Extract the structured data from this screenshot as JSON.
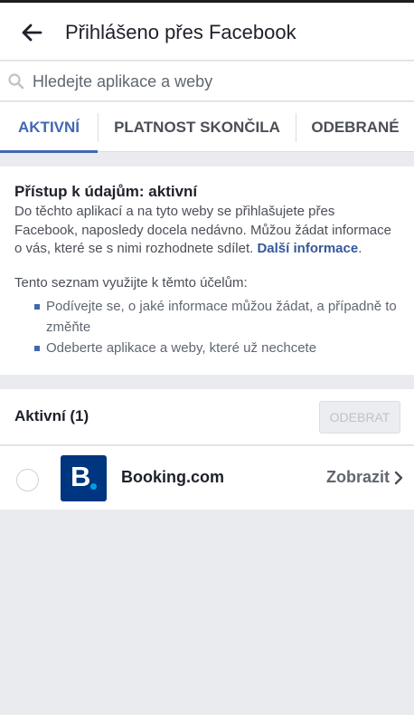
{
  "header": {
    "title": "Přihlášeno přes Facebook",
    "back_icon": "arrow-left-icon"
  },
  "search": {
    "placeholder": "Hledejte aplikace a weby",
    "value": "",
    "icon": "search-icon"
  },
  "tabs": [
    {
      "label": "AKTIVNÍ",
      "active": true
    },
    {
      "label": "PLATNOST SKONČILA",
      "active": false
    },
    {
      "label": "ODEBRANÉ",
      "active": false
    }
  ],
  "info": {
    "title": "Přístup k údajům: aktivní",
    "text": "Do těchto aplikací a na tyto weby se přihlašujete přes Facebook, naposledy docela nedávno. Můžou žádat informace o vás, které se s nimi rozhodnete sdílet.",
    "link": "Další informace",
    "after_link": ".",
    "purpose_title": "Tento seznam využijte k těmto účelům:",
    "bullets": [
      "Podívejte se, o jaké informace můžou žádat, a případně to změňte",
      "Odeberte aplikace a weby, které už nechcete"
    ]
  },
  "active_section": {
    "title": "Aktivní (1)",
    "remove_label": "ODEBRAT"
  },
  "apps": [
    {
      "name": "Booking.com",
      "logo_letter": "B",
      "view_label": "Zobrazit",
      "chevron_icon": "chevron-right-icon"
    }
  ],
  "colors": {
    "accent": "#4267b2",
    "link": "#365899",
    "booking_blue": "#003580",
    "booking_dot": "#009fe3",
    "background": "#e9ebee"
  }
}
